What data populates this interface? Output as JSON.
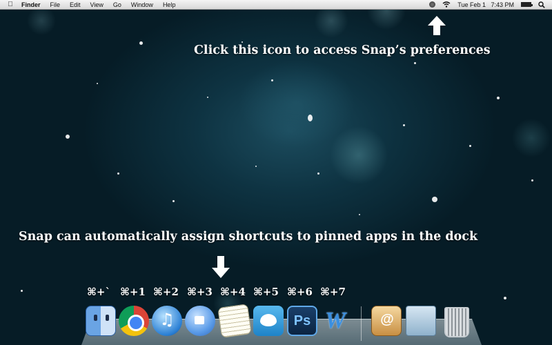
{
  "menubar": {
    "apple_symbol": "",
    "items": [
      "Finder",
      "File",
      "Edit",
      "View",
      "Go",
      "Window",
      "Help"
    ],
    "status": {
      "datetime": "Tue Feb 1   7:43 PM"
    }
  },
  "annotations": {
    "prefs_caption": "Click this icon to access Snap’s preferences",
    "dock_caption": "Snap can automatically assign shortcuts to pinned apps in the dock"
  },
  "shortcuts": [
    "⌘+`",
    "⌘+1",
    "⌘+2",
    "⌘+3",
    "⌘+4",
    "⌘+5",
    "⌘+6",
    "⌘+7"
  ],
  "dock": {
    "apps": [
      {
        "name": "Finder",
        "icon": "finder-icon"
      },
      {
        "name": "Google Chrome",
        "icon": "chrome-icon"
      },
      {
        "name": "iTunes",
        "icon": "itunes-icon"
      },
      {
        "name": "iChat",
        "icon": "ichat-icon"
      },
      {
        "name": "TextEdit",
        "icon": "textedit-icon"
      },
      {
        "name": "Twitter",
        "icon": "twitter-icon"
      },
      {
        "name": "Photoshop",
        "icon": "photoshop-icon",
        "glyph": "Ps"
      },
      {
        "name": "Word",
        "icon": "word-icon",
        "glyph": "W"
      }
    ],
    "stacks": [
      {
        "name": "Applications",
        "icon": "applications-stack-icon"
      },
      {
        "name": "Documents",
        "icon": "documents-stack-icon"
      },
      {
        "name": "Trash",
        "icon": "trash-icon"
      }
    ]
  },
  "battery_level": 1.0,
  "colors": {
    "annotation_text": "#ffffff",
    "menubar": "#e6e6e6",
    "wallpaper": "#0e3342"
  }
}
